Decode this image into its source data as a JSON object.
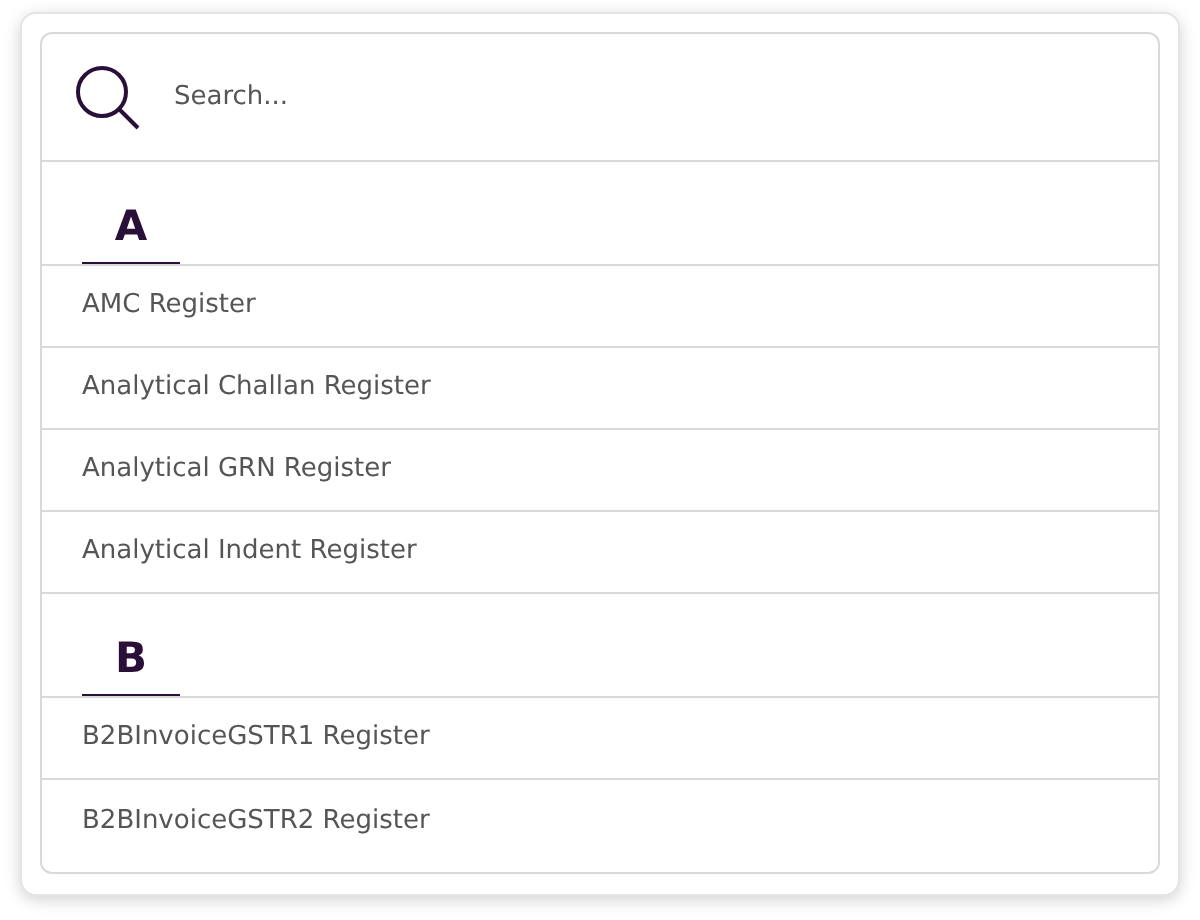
{
  "search": {
    "placeholder": "Search..."
  },
  "groups": [
    {
      "letter": "A",
      "items": [
        "AMC Register",
        "Analytical Challan Register",
        "Analytical GRN Register",
        "Analytical Indent Register"
      ]
    },
    {
      "letter": "B",
      "items": [
        "B2BInvoiceGSTR1 Register",
        "B2BInvoiceGSTR2 Register"
      ]
    }
  ]
}
